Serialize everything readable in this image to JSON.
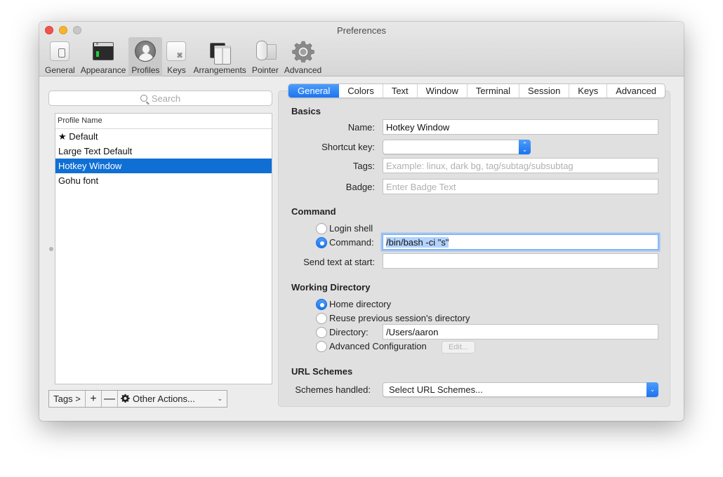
{
  "window": {
    "title": "Preferences"
  },
  "toolbar": {
    "items": [
      {
        "label": "General",
        "icon": "general-icon"
      },
      {
        "label": "Appearance",
        "icon": "appearance-icon"
      },
      {
        "label": "Profiles",
        "icon": "profiles-icon",
        "active": true
      },
      {
        "label": "Keys",
        "icon": "keys-icon"
      },
      {
        "label": "Arrangements",
        "icon": "arrangements-icon"
      },
      {
        "label": "Pointer",
        "icon": "pointer-icon"
      },
      {
        "label": "Advanced",
        "icon": "gear-icon"
      }
    ]
  },
  "sidebar": {
    "search_placeholder": "Search",
    "column_header": "Profile Name",
    "profiles": [
      {
        "name": "★ Default"
      },
      {
        "name": "Large Text Default"
      },
      {
        "name": "Hotkey Window",
        "selected": true
      },
      {
        "name": "Gohu font"
      }
    ],
    "bottom_bar": {
      "tags_label": "Tags >",
      "add_label": "+",
      "remove_label": "—",
      "other_actions_label": "Other Actions...",
      "chevron": "⌄"
    }
  },
  "tabs": {
    "items": [
      "General",
      "Colors",
      "Text",
      "Window",
      "Terminal",
      "Session",
      "Keys",
      "Advanced"
    ],
    "active": "General"
  },
  "basics": {
    "title": "Basics",
    "name_label": "Name:",
    "name_value": "Hotkey Window",
    "shortcut_label": "Shortcut key:",
    "shortcut_value": "",
    "tags_label": "Tags:",
    "tags_placeholder": "Example: linux, dark bg, tag/subtag/subsubtag",
    "badge_label": "Badge:",
    "badge_placeholder": "Enter Badge Text"
  },
  "command": {
    "title": "Command",
    "login_shell_label": "Login shell",
    "command_label": "Command:",
    "command_value": "/bin/bash -ci \"s\"",
    "selected_option": "Command",
    "send_text_label": "Send text at start:",
    "send_text_value": ""
  },
  "working_directory": {
    "title": "Working Directory",
    "home_label": "Home directory",
    "reuse_label": "Reuse previous session's directory",
    "directory_label": "Directory:",
    "directory_value": "/Users/aaron",
    "advanced_label": "Advanced Configuration",
    "edit_label": "Edit...",
    "selected_option": "Home directory"
  },
  "url_schemes": {
    "title": "URL Schemes",
    "schemes_label": "Schemes handled:",
    "schemes_value": "Select URL Schemes..."
  },
  "colors": {
    "accent": "#1a74f0",
    "selection": "#0f6fd5",
    "close": "#f2544d",
    "minimize": "#f8b42e",
    "zoom_disabled": "#c7c7c7"
  }
}
